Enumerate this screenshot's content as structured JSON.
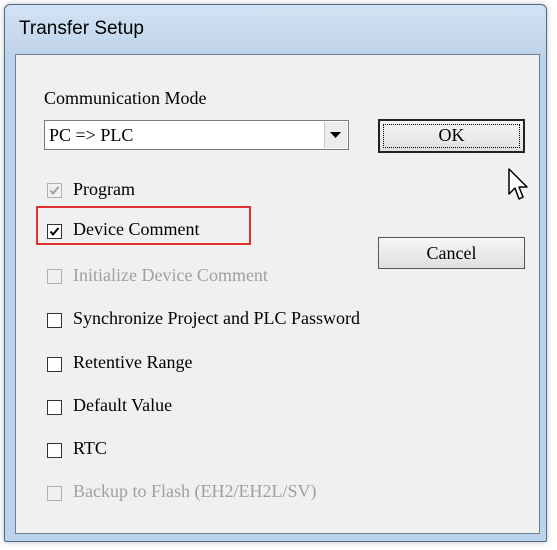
{
  "window": {
    "title": "Transfer Setup"
  },
  "communication_mode": {
    "label": "Communication Mode",
    "selected_value": "PC => PLC"
  },
  "buttons": {
    "ok_label": "OK",
    "cancel_label": "Cancel"
  },
  "options": [
    {
      "label": "Program",
      "checked": true,
      "enabled": false
    },
    {
      "label": "Device Comment",
      "checked": true,
      "enabled": true,
      "highlighted": true
    },
    {
      "label": "Initialize Device Comment",
      "checked": false,
      "enabled": false
    },
    {
      "label": "Synchronize Project and PLC Password",
      "checked": false,
      "enabled": true
    },
    {
      "label": "Retentive Range",
      "checked": false,
      "enabled": true
    },
    {
      "label": "Default Value",
      "checked": false,
      "enabled": true
    },
    {
      "label": "RTC",
      "checked": false,
      "enabled": true
    },
    {
      "label": "Backup to Flash (EH2/EH2L/SV)",
      "checked": false,
      "enabled": false
    }
  ],
  "colors": {
    "title_bar": "#bdd2ea",
    "dialog_background": "#f0f0f0",
    "highlight_border": "#e03030",
    "disabled_text": "#a0a0a0"
  }
}
